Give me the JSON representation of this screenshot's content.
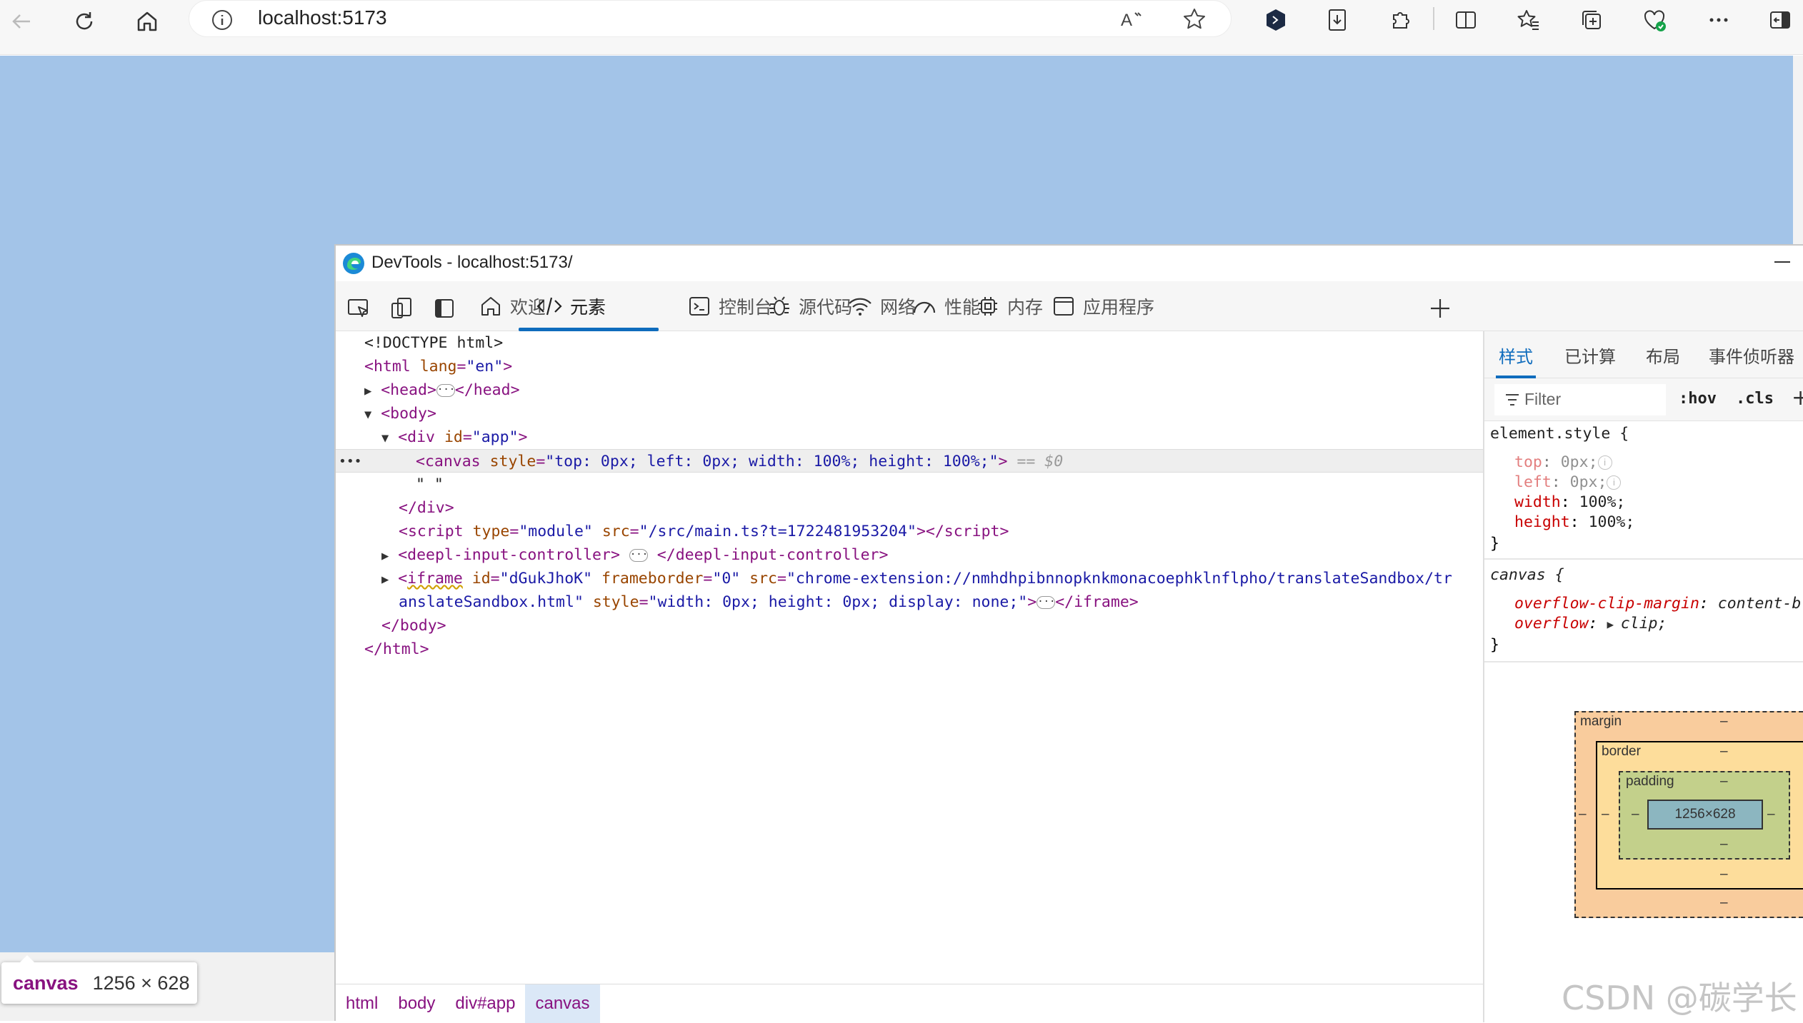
{
  "browser": {
    "url": "localhost:5173"
  },
  "tooltip": {
    "tag": "canvas",
    "dims": "1256 × 628"
  },
  "devtools": {
    "title": "DevTools - localhost:5173/",
    "tabs": [
      {
        "label": "欢迎",
        "icon": "home-icon"
      },
      {
        "label": "元素",
        "icon": "code-icon",
        "active": true
      },
      {
        "label": "控制台",
        "icon": "console-icon"
      },
      {
        "label": "源代码",
        "icon": "bug-icon"
      },
      {
        "label": "网络",
        "icon": "wifi-icon"
      },
      {
        "label": "性能",
        "icon": "gauge-icon"
      },
      {
        "label": "内存",
        "icon": "chip-icon"
      },
      {
        "label": "应用程序",
        "icon": "app-icon"
      }
    ],
    "dom": {
      "doctype": "<!DOCTYPE html>",
      "html_open_tag": "html",
      "html_attr": "lang",
      "html_attr_val": "\"en\"",
      "head": "head",
      "body": "body",
      "div": "div",
      "div_attr": "id",
      "div_attr_val": "\"app\"",
      "canvas_tag": "canvas",
      "canvas_attr": "style",
      "canvas_val": "\"top: 0px; left: 0px; width: 100%; height: 100%;\"",
      "canvas_sel": "== $0",
      "text_node": "\" \"",
      "script_tag": "script",
      "script_type_attr": "type",
      "script_type_val": "\"module\"",
      "script_src_attr": "src",
      "script_src_val": "\"/src/main.ts?t=1722481953204\"",
      "deepl_tag": "deepl-input-controller",
      "iframe_tag": "iframe",
      "iframe_id_attr": "id",
      "iframe_id_val": "\"dGukJhoK\"",
      "iframe_fb_attr": "frameborder",
      "iframe_fb_val": "\"0\"",
      "iframe_src_attr": "src",
      "iframe_src_val_1": "\"chrome-extension://nmhdhpibnnopknkmonacoephklnflpho/translateSandbox/tr",
      "iframe_src_val_2": "anslateSandbox.html\"",
      "iframe_style_attr": "style",
      "iframe_style_val": "\"width: 0px; height: 0px; display: none;\""
    },
    "breadcrumb": [
      "html",
      "body",
      "div#app",
      "canvas"
    ],
    "styles": {
      "tabs": [
        "样式",
        "已计算",
        "布局",
        "事件侦听器"
      ],
      "filter_placeholder": "Filter",
      "hov": ":hov",
      "cls": ".cls",
      "element_style_selector": "element.style {",
      "element_props": [
        {
          "name": "top",
          "value": "0px;",
          "faded": true
        },
        {
          "name": "left",
          "value": "0px;",
          "faded": true
        },
        {
          "name": "width",
          "value": "100%;"
        },
        {
          "name": "height",
          "value": "100%;"
        }
      ],
      "canvas_selector": "canvas",
      "canvas_props": [
        {
          "name": "overflow-clip-margin",
          "value": "content-b"
        },
        {
          "name": "overflow",
          "value": "clip;"
        }
      ],
      "close_brace": "}",
      "open_brace": "{"
    },
    "box_model": {
      "margin_label": "margin",
      "border_label": "border",
      "padding_label": "padding",
      "content": "1256×628",
      "dash": "–"
    }
  },
  "watermark": "CSDN @碳学长"
}
